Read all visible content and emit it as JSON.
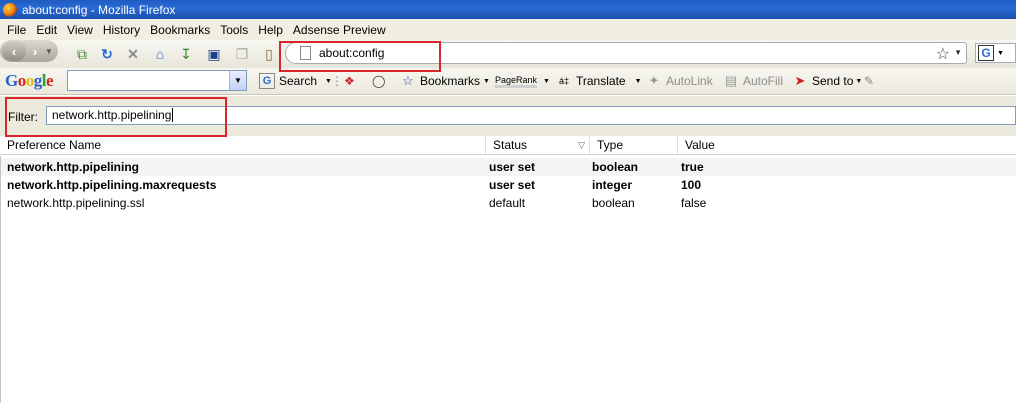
{
  "window": {
    "title": "about:config - Mozilla Firefox"
  },
  "menu": [
    "File",
    "Edit",
    "View",
    "History",
    "Bookmarks",
    "Tools",
    "Help",
    "Adsense Preview"
  ],
  "navbar": {
    "url": "about:config"
  },
  "google_toolbar": {
    "logo_letters": [
      "G",
      "o",
      "o",
      "g",
      "l",
      "e"
    ],
    "search_label": "Search",
    "bookmarks_label": "Bookmarks",
    "pagerank_label": "PageRank",
    "translate_label": "Translate",
    "autolink_label": "AutoLink",
    "autofill_label": "AutoFill",
    "sendto_label": "Send to"
  },
  "filter": {
    "label": "Filter:",
    "value": "network.http.pipelining"
  },
  "table": {
    "columns": [
      "Preference Name",
      "Status",
      "Type",
      "Value"
    ],
    "rows": [
      {
        "name": "network.http.pipelining",
        "status": "user set",
        "type": "boolean",
        "value": "true"
      },
      {
        "name": "network.http.pipelining.maxrequests",
        "status": "user set",
        "type": "integer",
        "value": "100"
      },
      {
        "name": "network.http.pipelining.ssl",
        "status": "default",
        "type": "boolean",
        "value": "false"
      }
    ]
  },
  "colors": {
    "highlight": "#d9262b",
    "titlebar": "#1f5cc2"
  }
}
